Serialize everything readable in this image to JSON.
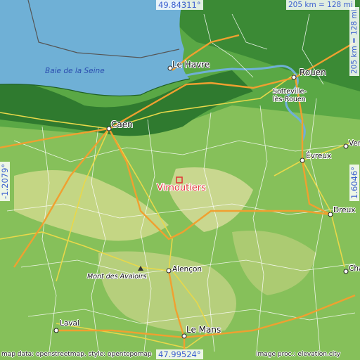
{
  "coords": {
    "top": "49.84311°",
    "bottom": "47.99524°",
    "left": "-1.2079°",
    "right": "1.6046°"
  },
  "scale": {
    "top": "205 km = 128 mi",
    "right": "205 km = 128 mi"
  },
  "labels": {
    "bay": "Baie de la Seine",
    "le_havre": "Le Havre",
    "rouen": "Rouen",
    "sotteville": "Sotteville-lès-Rouen",
    "caen": "Caen",
    "evreux": "Évreux",
    "vimoutiers": "Vimoutiers",
    "dreux": "Dreux",
    "alencon": "Alençon",
    "mont_avaloirs": "Mont des Avaloirs",
    "laval": "Laval",
    "le_mans": "Le Mans",
    "ver": "Ver",
    "cha": "Cha"
  },
  "attribution": {
    "left": "map data: openstreetmap, style: opentopomap",
    "right": "image proc.: elevation.city"
  },
  "colors": {
    "sea": "#6fb0d6",
    "lowland": "#3f8f3a",
    "midland": "#8cc45a",
    "highland": "#d7dc9a",
    "road_main": "#f0a030",
    "road_secondary": "#e8d84a",
    "road_minor": "#ffffff",
    "marker": "#e23a3a"
  }
}
